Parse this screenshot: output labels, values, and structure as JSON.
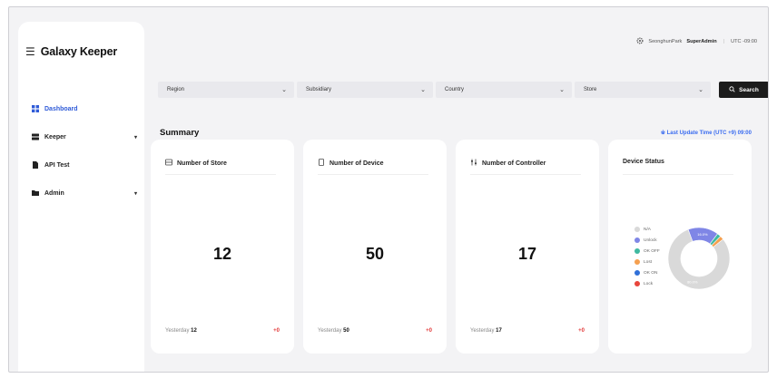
{
  "brand": {
    "title": "Galaxy Keeper"
  },
  "sidebar": {
    "items": [
      {
        "label": "Dashboard",
        "icon": "grid-icon",
        "active": true
      },
      {
        "label": "Keeper",
        "icon": "server-icon",
        "caret": "▾"
      },
      {
        "label": "API Test",
        "icon": "document-icon"
      },
      {
        "label": "Admin",
        "icon": "folder-icon",
        "caret": "▾"
      }
    ]
  },
  "topbar": {
    "user": "SeonghunPark",
    "role": "SuperAdmin",
    "separator": "|",
    "timezone": "UTC -09:00"
  },
  "filters": {
    "region": "Region",
    "subsidiary": "Subsidiary",
    "country": "Country",
    "store": "Store",
    "search_label": "Search"
  },
  "summary": {
    "title": "Summary",
    "last_update": "※ Last Update Time (UTC +9) 09:00"
  },
  "cards": {
    "store": {
      "title": "Number of Store",
      "value": "12",
      "yesterday_label": "Yesterday",
      "yesterday_value": "12",
      "delta": "+0"
    },
    "device": {
      "title": "Number of Device",
      "value": "50",
      "yesterday_label": "Yesterday",
      "yesterday_value": "50",
      "delta": "+0"
    },
    "controller": {
      "title": "Number of Controller",
      "value": "17",
      "yesterday_label": "Yesterday",
      "yesterday_value": "17",
      "delta": "+0"
    }
  },
  "device_status": {
    "title": "Device Status",
    "legend": [
      {
        "label": "N/A",
        "color": "#d9d9d9"
      },
      {
        "label": "Unlock",
        "color": "#7f86e6"
      },
      {
        "label": "OK OFF",
        "color": "#3fb9a0"
      },
      {
        "label": "Lost",
        "color": "#f5a04f"
      },
      {
        "label": "OK ON",
        "color": "#2f6fd8"
      },
      {
        "label": "Lock",
        "color": "#e8453c"
      }
    ],
    "chart_data": {
      "type": "pie",
      "categories": [
        "N/A",
        "Unlock",
        "OK OFF",
        "Lost",
        "OK ON",
        "Lock"
      ],
      "values": [
        80,
        16,
        2,
        2,
        0,
        0
      ],
      "slice_labels": [
        "80.0%",
        "16.0%",
        "",
        "",
        "",
        ""
      ]
    }
  }
}
